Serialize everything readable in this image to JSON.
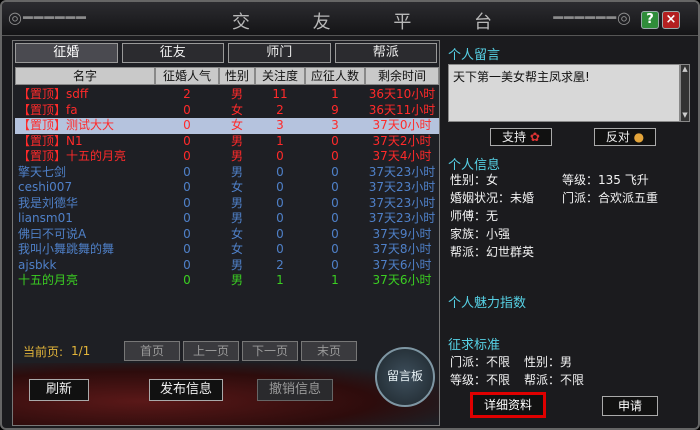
{
  "window": {
    "title_chars": [
      "交",
      "友",
      "平",
      "台"
    ],
    "help_label": "?",
    "close_label": "×"
  },
  "tabs": [
    "征婚",
    "征友",
    "师门",
    "帮派"
  ],
  "columns": [
    "名字",
    "征婚人气",
    "性别",
    "关注度",
    "应征人数",
    "剩余时间"
  ],
  "rows": [
    {
      "name": "【置顶】sdff",
      "popularity": "2",
      "gender": "男",
      "attention": "11",
      "applicants": "1",
      "time": "36天10小时",
      "color": "red",
      "selected": false
    },
    {
      "name": "【置顶】fa",
      "popularity": "0",
      "gender": "女",
      "attention": "2",
      "applicants": "9",
      "time": "36天11小时",
      "color": "red",
      "selected": false
    },
    {
      "name": "【置顶】测试大大",
      "popularity": "0",
      "gender": "女",
      "attention": "3",
      "applicants": "3",
      "time": "37天0小时",
      "color": "red",
      "selected": true
    },
    {
      "name": "【置顶】N1",
      "popularity": "0",
      "gender": "男",
      "attention": "1",
      "applicants": "0",
      "time": "37天2小时",
      "color": "red",
      "selected": false
    },
    {
      "name": "【置顶】十五的月亮",
      "popularity": "0",
      "gender": "男",
      "attention": "0",
      "applicants": "0",
      "time": "37天4小时",
      "color": "red",
      "selected": false
    },
    {
      "name": "擎天七剑",
      "popularity": "0",
      "gender": "男",
      "attention": "0",
      "applicants": "0",
      "time": "37天23小时",
      "color": "blue",
      "selected": false
    },
    {
      "name": "ceshi007",
      "popularity": "0",
      "gender": "女",
      "attention": "0",
      "applicants": "0",
      "time": "37天23小时",
      "color": "blue",
      "selected": false
    },
    {
      "name": "我是刘德华",
      "popularity": "0",
      "gender": "男",
      "attention": "0",
      "applicants": "0",
      "time": "37天23小时",
      "color": "blue",
      "selected": false
    },
    {
      "name": "liansm01",
      "popularity": "0",
      "gender": "男",
      "attention": "0",
      "applicants": "0",
      "time": "37天23小时",
      "color": "blue",
      "selected": false
    },
    {
      "name": "佛曰不可说A",
      "popularity": "0",
      "gender": "女",
      "attention": "0",
      "applicants": "0",
      "time": "37天9小时",
      "color": "blue",
      "selected": false
    },
    {
      "name": "我叫小舞跳舞的舞",
      "popularity": "0",
      "gender": "女",
      "attention": "0",
      "applicants": "0",
      "time": "37天8小时",
      "color": "blue",
      "selected": false
    },
    {
      "name": "ajsbkk",
      "popularity": "0",
      "gender": "男",
      "attention": "2",
      "applicants": "0",
      "time": "37天6小时",
      "color": "blue",
      "selected": false
    },
    {
      "name": "十五的月亮",
      "popularity": "0",
      "gender": "男",
      "attention": "1",
      "applicants": "1",
      "time": "37天6小时",
      "color": "green",
      "selected": false
    }
  ],
  "pager": {
    "label": "当前页:",
    "page": "1/1",
    "first": "首页",
    "prev": "上一页",
    "next": "下一页",
    "last": "末页"
  },
  "actions": {
    "refresh": "刷新",
    "publish": "发布信息",
    "revoke": "撤销信息",
    "board": "留言板"
  },
  "right": {
    "message_title": "个人留言",
    "message_text": "天下第一美女帮主凤求凰!",
    "support": "支持",
    "oppose": "反对",
    "info_title": "个人信息",
    "gender": "性别：女",
    "level": "等级：135 飞升",
    "marital": "婚姻状况：未婚",
    "sect": "门派：合欢派五重",
    "master": "师傅：无",
    "family": "家族：小强",
    "guild": "帮派：幻世群英",
    "charm_title": "个人魅力指数",
    "criteria_title": "征求标准",
    "crit_sect": "门派：不限",
    "crit_gender": "性别：男",
    "crit_level": "等级：不限",
    "crit_guild": "帮派：不限",
    "detail": "详细资料",
    "apply": "申请"
  },
  "colors": {
    "red": "#ff2a2a",
    "blue": "#4f80c8",
    "green": "#3bcf22",
    "accent_cyan": "#56d0e4",
    "highlight_border": "#e00000"
  }
}
